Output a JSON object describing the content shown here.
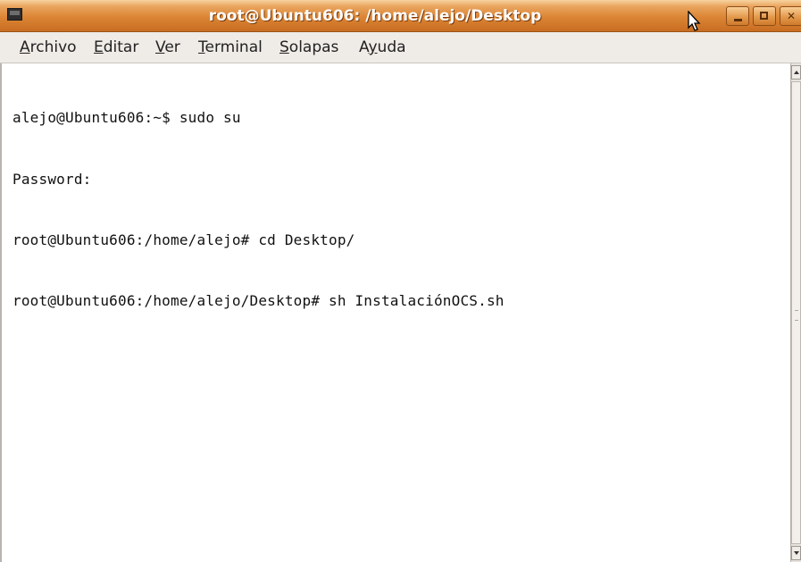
{
  "window": {
    "title": "root@Ubuntu606: /home/alejo/Desktop"
  },
  "menu": {
    "items": [
      {
        "mnemonic": "A",
        "rest": "rchivo"
      },
      {
        "mnemonic": "E",
        "rest": "ditar"
      },
      {
        "mnemonic": "V",
        "rest": "er"
      },
      {
        "mnemonic": "T",
        "rest": "erminal"
      },
      {
        "mnemonic": "S",
        "rest": "olapas"
      },
      {
        "prefix": "A",
        "mnemonic": "y",
        "rest": "uda"
      }
    ]
  },
  "terminal": {
    "lines": [
      "alejo@Ubuntu606:~$ sudo su",
      "Password:",
      "root@Ubuntu606:/home/alejo# cd Desktop/",
      "root@Ubuntu606:/home/alejo/Desktop# sh InstalaciónOCS.sh"
    ]
  },
  "icons": {
    "app": "terminal-icon",
    "minimize": "minimize-icon",
    "maximize": "maximize-icon",
    "close": "close-icon",
    "cursor": "mouse-cursor-icon"
  },
  "colors": {
    "titlebar": "#db8535",
    "menubar": "#efebe7",
    "terminal_bg": "#ffffff",
    "terminal_fg": "#111111"
  }
}
